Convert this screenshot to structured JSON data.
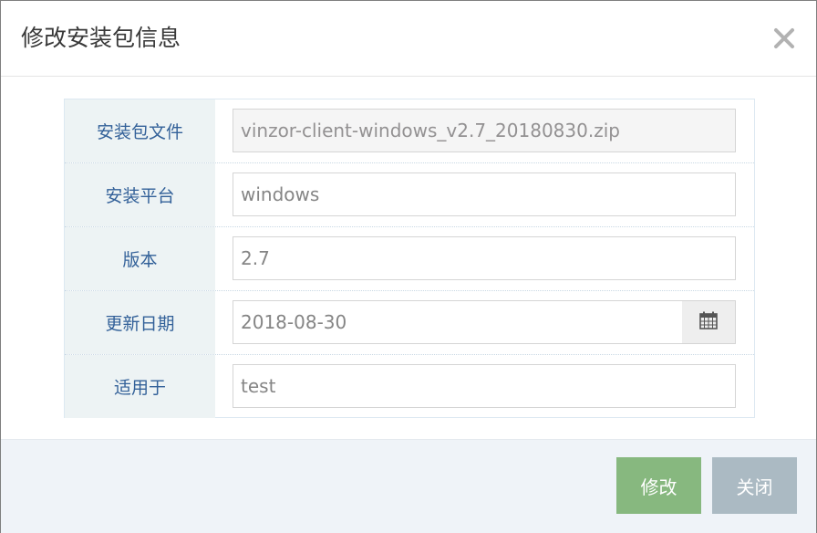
{
  "dialog": {
    "title": "修改安装包信息",
    "close_icon": "close-icon"
  },
  "form": {
    "fields": [
      {
        "label": "安装包文件",
        "value": "vinzor-client-windows_v2.7_20180830.zip",
        "readonly": true
      },
      {
        "label": "安装平台",
        "value": "windows"
      },
      {
        "label": "版本",
        "value": "2.7"
      },
      {
        "label": "更新日期",
        "value": "2018-08-30",
        "icon": "calendar-icon"
      },
      {
        "label": "适用于",
        "value": "test"
      }
    ]
  },
  "footer": {
    "modify_label": "修改",
    "close_label": "关闭"
  },
  "colors": {
    "label_text": "#336199",
    "label_bg": "#edf3f4",
    "modify_button": "#87b87f",
    "close_button": "#abbac3",
    "footer_bg": "#eff3f8"
  }
}
